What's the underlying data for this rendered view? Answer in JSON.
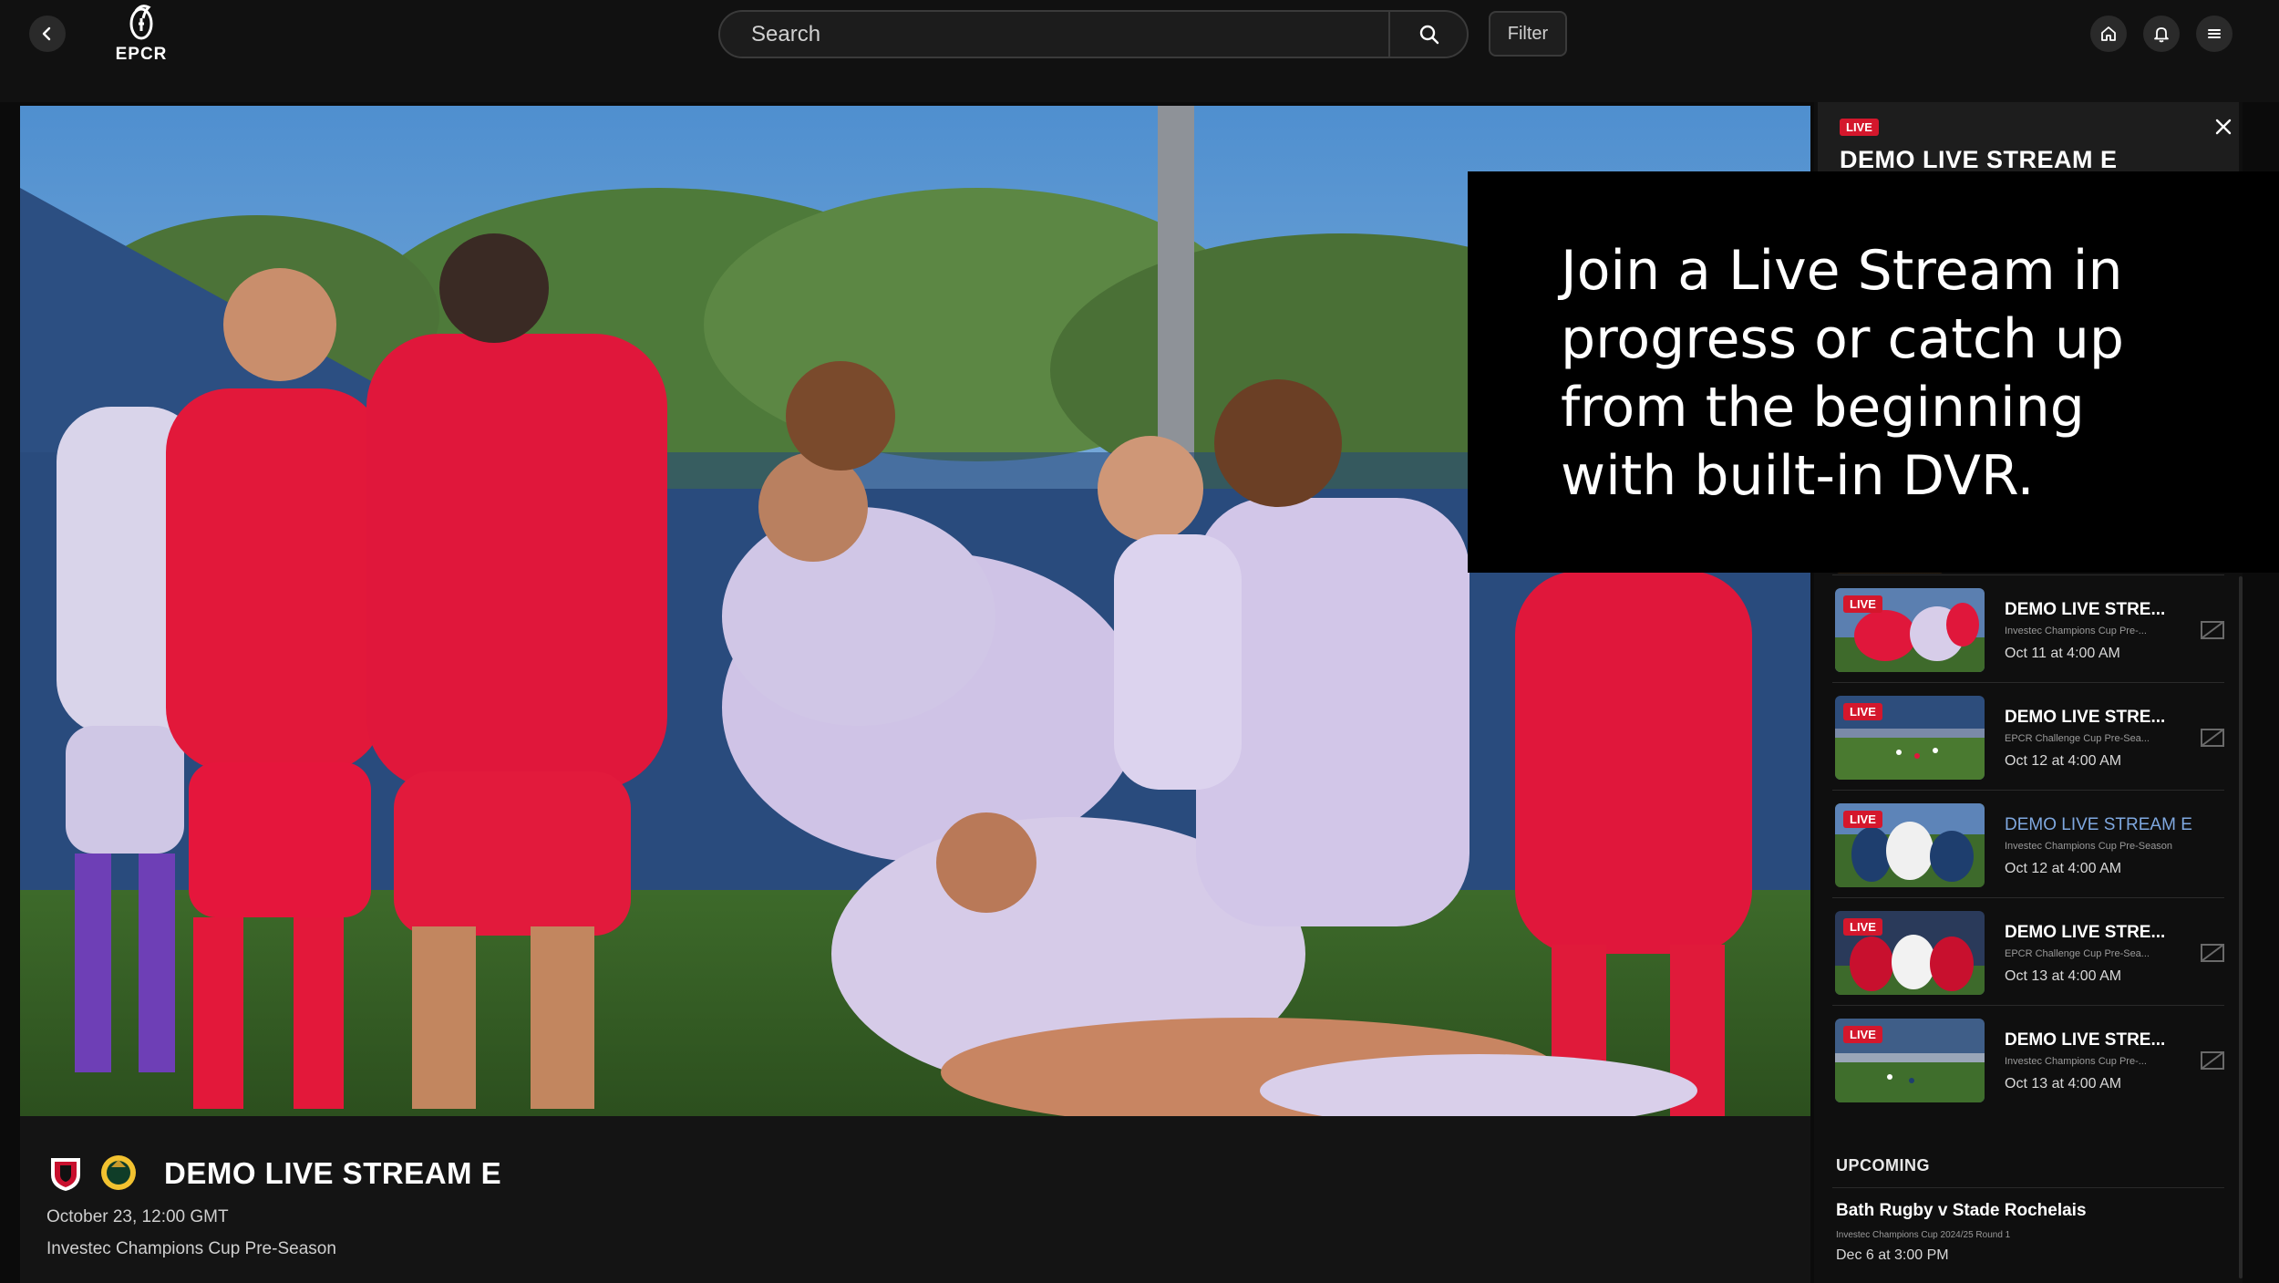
{
  "header": {
    "logo_text": "EPCR",
    "search_placeholder": "Search",
    "filter_label": "Filter",
    "icons": [
      "back-arrow-icon",
      "search-icon",
      "home-icon",
      "bell-icon",
      "menu-icon"
    ]
  },
  "player": {
    "title": "DEMO LIVE STREAM E",
    "date": "October 23, 12:00 GMT",
    "competition": "Investec Champions Cup Pre-Season"
  },
  "panel": {
    "live_label": "LIVE",
    "title": "DEMO LIVE STREAM E",
    "items": [
      {
        "live": "LIVE",
        "title": "DEMO LIVE STRE...",
        "competition": "Investec Champions Cup Pre-...",
        "time": "Oct 11 at 4:00 AM",
        "active": false
      },
      {
        "live": "LIVE",
        "title": "DEMO LIVE STRE...",
        "competition": "EPCR Challenge Cup Pre-Sea...",
        "time": "Oct 12 at 4:00 AM",
        "active": false
      },
      {
        "live": "LIVE",
        "title": "DEMO LIVE STREAM E",
        "competition": "Investec Champions Cup Pre-Season",
        "time": "Oct 12 at 4:00 AM",
        "active": true
      },
      {
        "live": "LIVE",
        "title": "DEMO LIVE STRE...",
        "competition": "EPCR Challenge Cup Pre-Sea...",
        "time": "Oct 13 at 4:00 AM",
        "active": false
      },
      {
        "live": "LIVE",
        "title": "DEMO LIVE STRE...",
        "competition": "Investec Champions Cup Pre-...",
        "time": "Oct 13 at 4:00 AM",
        "active": false
      }
    ],
    "upcoming_label": "UPCOMING",
    "upcoming": {
      "title": "Bath Rugby v Stade Rochelais",
      "competition": "Investec Champions Cup 2024/25 Round 1",
      "time": "Dec 6 at 3:00 PM"
    }
  },
  "overlay": {
    "text": "Join a Live Stream in progress or catch up from the beginning with built-in DVR."
  },
  "colors": {
    "live_red": "#d4172c",
    "active_blue": "#7fa8e0",
    "background": "#0b0b0b"
  }
}
